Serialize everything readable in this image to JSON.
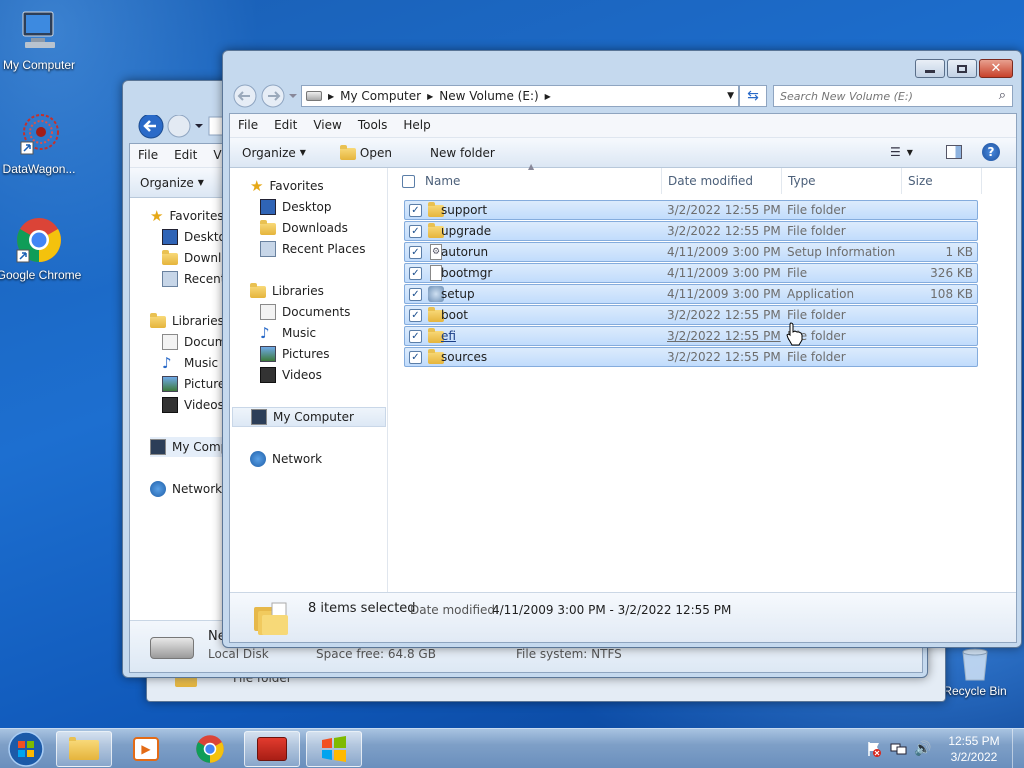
{
  "desktop": {
    "icons": [
      {
        "label": "My Computer",
        "icon": "computer-icon"
      },
      {
        "label": "DataWagon...",
        "icon": "datawagon-icon"
      },
      {
        "label": "Google Chrome",
        "icon": "chrome-icon"
      },
      {
        "label": "Recycle Bin",
        "icon": "recycle-bin-icon"
      }
    ]
  },
  "back_window": {
    "menu": [
      "File",
      "Edit",
      "Vi"
    ],
    "organize": "Organize",
    "nav": [
      "Favorites",
      "Desktop",
      "Downlo",
      "Recent P",
      "Libraries",
      "Docume",
      "Music",
      "Pictures",
      "Videos",
      "My Comp",
      "Network"
    ],
    "details": {
      "name": "Ne",
      "type": "Local Disk",
      "space_free": "Space free: 64.8 GB",
      "file_system": "File system:  NTFS",
      "sub": "File folder"
    }
  },
  "window": {
    "breadcrumb": [
      "My Computer",
      "New Volume (E:)"
    ],
    "search_placeholder": "Search New Volume (E:)",
    "menu": [
      "File",
      "Edit",
      "View",
      "Tools",
      "Help"
    ],
    "commands": {
      "organize": "Organize",
      "open": "Open",
      "new_folder": "New folder"
    },
    "nav": {
      "favorites": "Favorites",
      "fav_items": [
        "Desktop",
        "Downloads",
        "Recent Places"
      ],
      "libraries": "Libraries",
      "lib_items": [
        "Documents",
        "Music",
        "Pictures",
        "Videos"
      ],
      "computer": "My Computer",
      "network": "Network"
    },
    "columns": {
      "name": "Name",
      "date": "Date modified",
      "type": "Type",
      "size": "Size"
    },
    "files": [
      {
        "name": "support",
        "date": "3/2/2022 12:55 PM",
        "type": "File folder",
        "size": "",
        "icon": "folder-icon"
      },
      {
        "name": "upgrade",
        "date": "3/2/2022 12:55 PM",
        "type": "File folder",
        "size": "",
        "icon": "folder-icon"
      },
      {
        "name": "autorun",
        "date": "4/11/2009 3:00 PM",
        "type": "Setup Information",
        "size": "1 KB",
        "icon": "settings-file-icon"
      },
      {
        "name": "bootmgr",
        "date": "4/11/2009 3:00 PM",
        "type": "File",
        "size": "326 KB",
        "icon": "file-icon"
      },
      {
        "name": "setup",
        "date": "4/11/2009 3:00 PM",
        "type": "Application",
        "size": "108 KB",
        "icon": "setup-app-icon"
      },
      {
        "name": "boot",
        "date": "3/2/2022 12:55 PM",
        "type": "File folder",
        "size": "",
        "icon": "folder-icon"
      },
      {
        "name": "efi",
        "date": "3/2/2022 12:55 PM",
        "type": "File folder",
        "size": "",
        "icon": "folder-icon"
      },
      {
        "name": "sources",
        "date": "3/2/2022 12:55 PM",
        "type": "File folder",
        "size": "",
        "icon": "folder-icon"
      }
    ],
    "status": {
      "selected": "8 items selected",
      "date_label": "Date modified:",
      "date_range": "4/11/2009 3:00 PM - 3/2/2022 12:55 PM"
    }
  },
  "taskbar": {
    "time": "12:55 PM",
    "date": "3/2/2022",
    "apps": [
      "start-orb-icon",
      "explorer-icon",
      "media-player-icon",
      "chrome-icon",
      "toolbox-icon",
      "windows-flag-icon"
    ]
  }
}
